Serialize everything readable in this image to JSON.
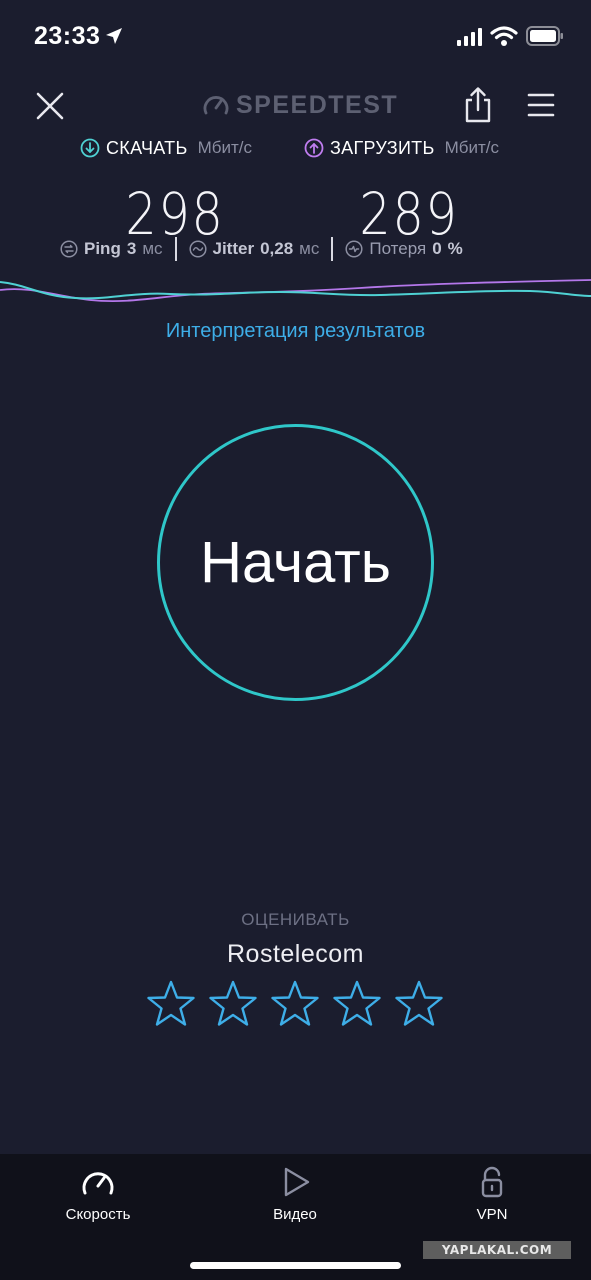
{
  "status_bar": {
    "time": "23:33"
  },
  "header": {
    "brand": "SPEEDTEST"
  },
  "results": {
    "download": {
      "title": "СКАЧАТЬ",
      "unit": "Мбит/с",
      "value": "298"
    },
    "upload": {
      "title": "ЗАГРУЗИТЬ",
      "unit": "Мбит/с",
      "value": "289"
    }
  },
  "stats": {
    "ping": {
      "label": "Ping",
      "value": "3",
      "unit": "мс"
    },
    "jitter": {
      "label": "Jitter",
      "value": "0,28",
      "unit": "мс"
    },
    "loss": {
      "label": "Потеря",
      "value": "0",
      "unit": "%"
    }
  },
  "interpret_link": "Интерпретация результатов",
  "start_button": "Начать",
  "rating": {
    "title": "ОЦЕНИВАТЬ",
    "provider": "Rostelecom",
    "stars_total": 5,
    "stars_filled": 0
  },
  "tabs": [
    {
      "label": "Скорость",
      "icon": "speedometer-icon"
    },
    {
      "label": "Видео",
      "icon": "play-icon"
    },
    {
      "label": "VPN",
      "icon": "unlock-icon"
    }
  ],
  "watermark": "YAPLAKAL.COM",
  "colors": {
    "background": "#1b1d2e",
    "download_accent": "#4fd1d3",
    "upload_accent": "#c07df0",
    "link": "#3eaee8",
    "start_ring": "#2fc7c9",
    "star": "#3eaee8",
    "tab_bar": "#10111a"
  }
}
